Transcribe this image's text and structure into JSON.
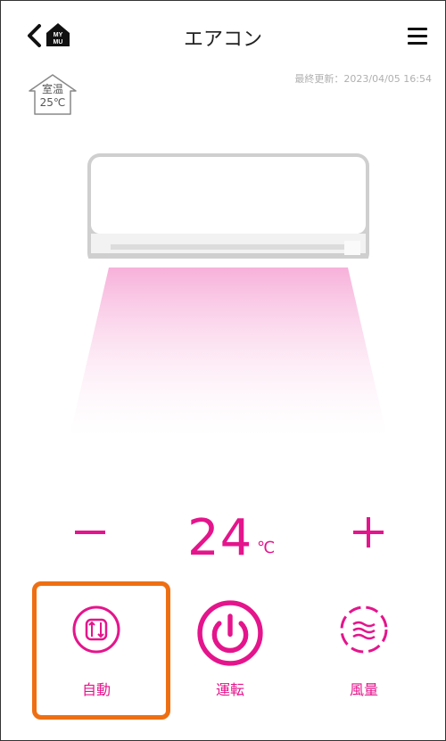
{
  "header": {
    "title": "エアコン",
    "home_badge_line1": "MY",
    "home_badge_line2": "MU"
  },
  "updated_text": "最終更新：2023/04/05 16:54",
  "room_temp": {
    "label": "室温",
    "value": "25℃"
  },
  "setpoint": {
    "value": "24",
    "unit": "℃"
  },
  "buttons": {
    "auto": "自動",
    "power": "運転",
    "fan": "風量"
  },
  "colors": {
    "accent": "#e4158c",
    "highlight": "#ee6f12"
  }
}
